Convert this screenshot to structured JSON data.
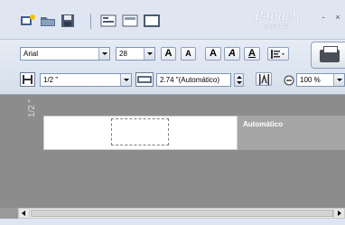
{
  "quick_access": {
    "icons": [
      "new-label-icon",
      "open-folder-icon",
      "save-icon",
      "text-box-icon",
      "layout-icon",
      "frame-icon"
    ]
  },
  "brand": {
    "logo": "P-touch",
    "subtitle": "Editor Lite"
  },
  "window_controls": {
    "minimize": "-",
    "close": "×"
  },
  "font": {
    "family": "Arial",
    "size": "28"
  },
  "text_buttons": {
    "grow": "A",
    "shrink": "A",
    "bold": "A",
    "italic": "A",
    "underline": "A"
  },
  "tape": {
    "width": "1/2 \"",
    "length": "2.74 \"(Automático)"
  },
  "zoom": {
    "value": "100 %"
  },
  "canvas": {
    "tape_label": "1/2 \"",
    "auto_label": "Automático"
  },
  "colors": {
    "canvas_bg": "#8c8c8c",
    "label_bg": "#ffffff",
    "auto_bg": "#a6a6a6",
    "title_bg": "#dfe6f1"
  }
}
